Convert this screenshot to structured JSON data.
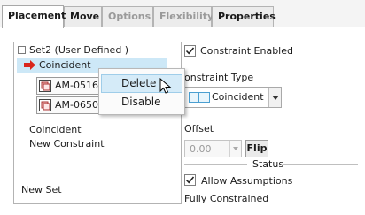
{
  "tabs": [
    {
      "label": "Placement",
      "state": "active"
    },
    {
      "label": "Move",
      "state": "enabled"
    },
    {
      "label": "Options",
      "state": "disabled"
    },
    {
      "label": "Flexibility",
      "state": "disabled"
    },
    {
      "label": "Properties",
      "state": "enabled"
    }
  ],
  "tree": {
    "set_label": "Set2 (User Defined )",
    "selected_constraint": "Coincident",
    "references": [
      "AM-0516:S",
      "AM-0650:S"
    ],
    "constraint_type_text": "Coincident",
    "new_constraint": "New Constraint",
    "new_set": "New Set"
  },
  "context_menu": {
    "items": [
      {
        "label": "Delete",
        "state": "hover"
      },
      {
        "label": "Disable",
        "state": "normal"
      }
    ]
  },
  "constraint": {
    "enabled_label": "Constraint Enabled",
    "enabled_checked": true,
    "type_label": "onstraint Type",
    "type_value": "Coincident"
  },
  "offset": {
    "label": "Offset",
    "value": "0.00",
    "flip_label": "Flip"
  },
  "status": {
    "heading": "Status",
    "allow_label": "Allow Assumptions",
    "allow_checked": true,
    "state_text": "Fully Constrained"
  },
  "colors": {
    "selection": "#cde8f7",
    "menu_hover": "#d5ebf8",
    "arrow": "#d9261c"
  }
}
